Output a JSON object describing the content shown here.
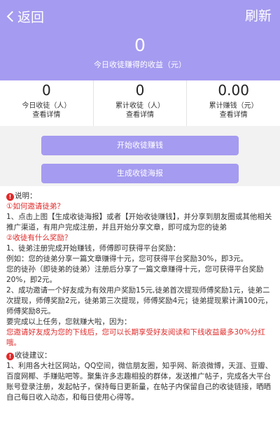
{
  "header": {
    "back_label": "返回",
    "refresh_label": "刷新",
    "today_earnings_value": "0",
    "today_earnings_label": "今日收徒赚得的收益（元）"
  },
  "stats": [
    {
      "value": "0",
      "label": "今日收徒（人）",
      "link": "查看详情"
    },
    {
      "value": "0",
      "label": "累计收徒（人）",
      "link": "查看详情"
    },
    {
      "value": "0.00",
      "label": "累计赚钱（元）",
      "link": "查看详情"
    }
  ],
  "buttons": {
    "start_label": "开始收徒赚钱",
    "poster_label": "生成收徒海报"
  },
  "colors": {
    "accent": "#a59bf0",
    "highlight": "#e02a2a",
    "panel_bg": "#f2f2f2"
  },
  "icons": {
    "info": "info-icon"
  },
  "content": {
    "info_icon_glyph": "!",
    "notes_title": "说明：",
    "q1": "①如何邀请徒弟？",
    "a1": "1、点击上图【生成收徒海报】或者【开始收徒赚钱】，并分享到朋友圈或其他相关推广渠道，有用户完成注册，并且开始分享文章，即可成为您的徒弟",
    "q2": "②收徒有什么奖励？",
    "a2_1": "1、徒弟注册完成开始赚钱，师傅即可获得平台奖励：",
    "a2_2": "例如：您的徒弟分享一篇文章赚得十元，您可获得平台奖励30%，即3元。",
    "a2_3": "您的徒孙（即徒弟的徒弟）注册后分享了一篇文章赚得十元，您可获得平台奖励20%，即2元。",
    "a2_4": "2、成功邀请一个好友成为有效用户奖励15元,徒弟首次提现师傅奖励1元，徒弟二次提现，师傅奖励2元，徒弟第三次提现，师傅奖励4元；徒弟提现累计满100元，师傅奖励8元。",
    "a2_5": "要完成以上任务，您就赚大啦，因为：",
    "highlight": "您邀请好友成为您的下线后，您可以长期享受好友阅读和下线收益最多30%分红哦。",
    "tips_title": "收徒建议：",
    "tip_1": "1、利用各大社区网站，QQ空间，微信朋友圈，知乎网、新浪微博，天涯、豆瓣、百度网椰、手赚贴吧等。聚集许多志趣相投的群体，发送推广帖子，完成各大平台账号登录注册，发起帖子，保持每日更新量，在帖子内保留自己的收徒链接，晒晒自己每日收入动态，和每日使用心得等。"
  }
}
